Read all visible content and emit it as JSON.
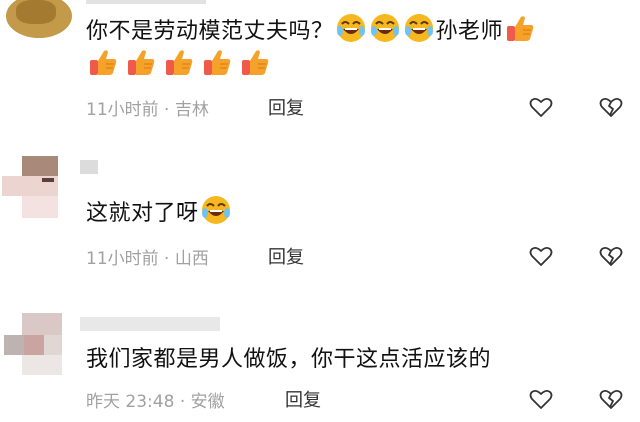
{
  "colors": {
    "meta": "#a1a1a1",
    "text": "#111111",
    "reply": "#333333",
    "emoji_face": "#f6b81e",
    "thumb": "#f6a12a",
    "cuff": "#ef5a4a"
  },
  "comments": [
    {
      "line1": "你不是劳动模范丈夫吗？",
      "mid_text": "孙老师",
      "time": "11小时前",
      "location": "吉林",
      "reply_label": "回复",
      "emoji_1": "laugh-cry-emoji",
      "emoji_2": "thumbs-up-emoji"
    },
    {
      "text": "这就对了呀",
      "time": "11小时前",
      "location": "山西",
      "reply_label": "回复",
      "emoji": "laugh-cry-emoji"
    },
    {
      "text": "我们家都是男人做饭，你干这点活应该的",
      "time": "昨天 23:48",
      "location": "安徽",
      "reply_label": "回复"
    }
  ],
  "icons": {
    "like": "heart-outline-icon",
    "dislike": "broken-heart-icon"
  },
  "separator": "·"
}
